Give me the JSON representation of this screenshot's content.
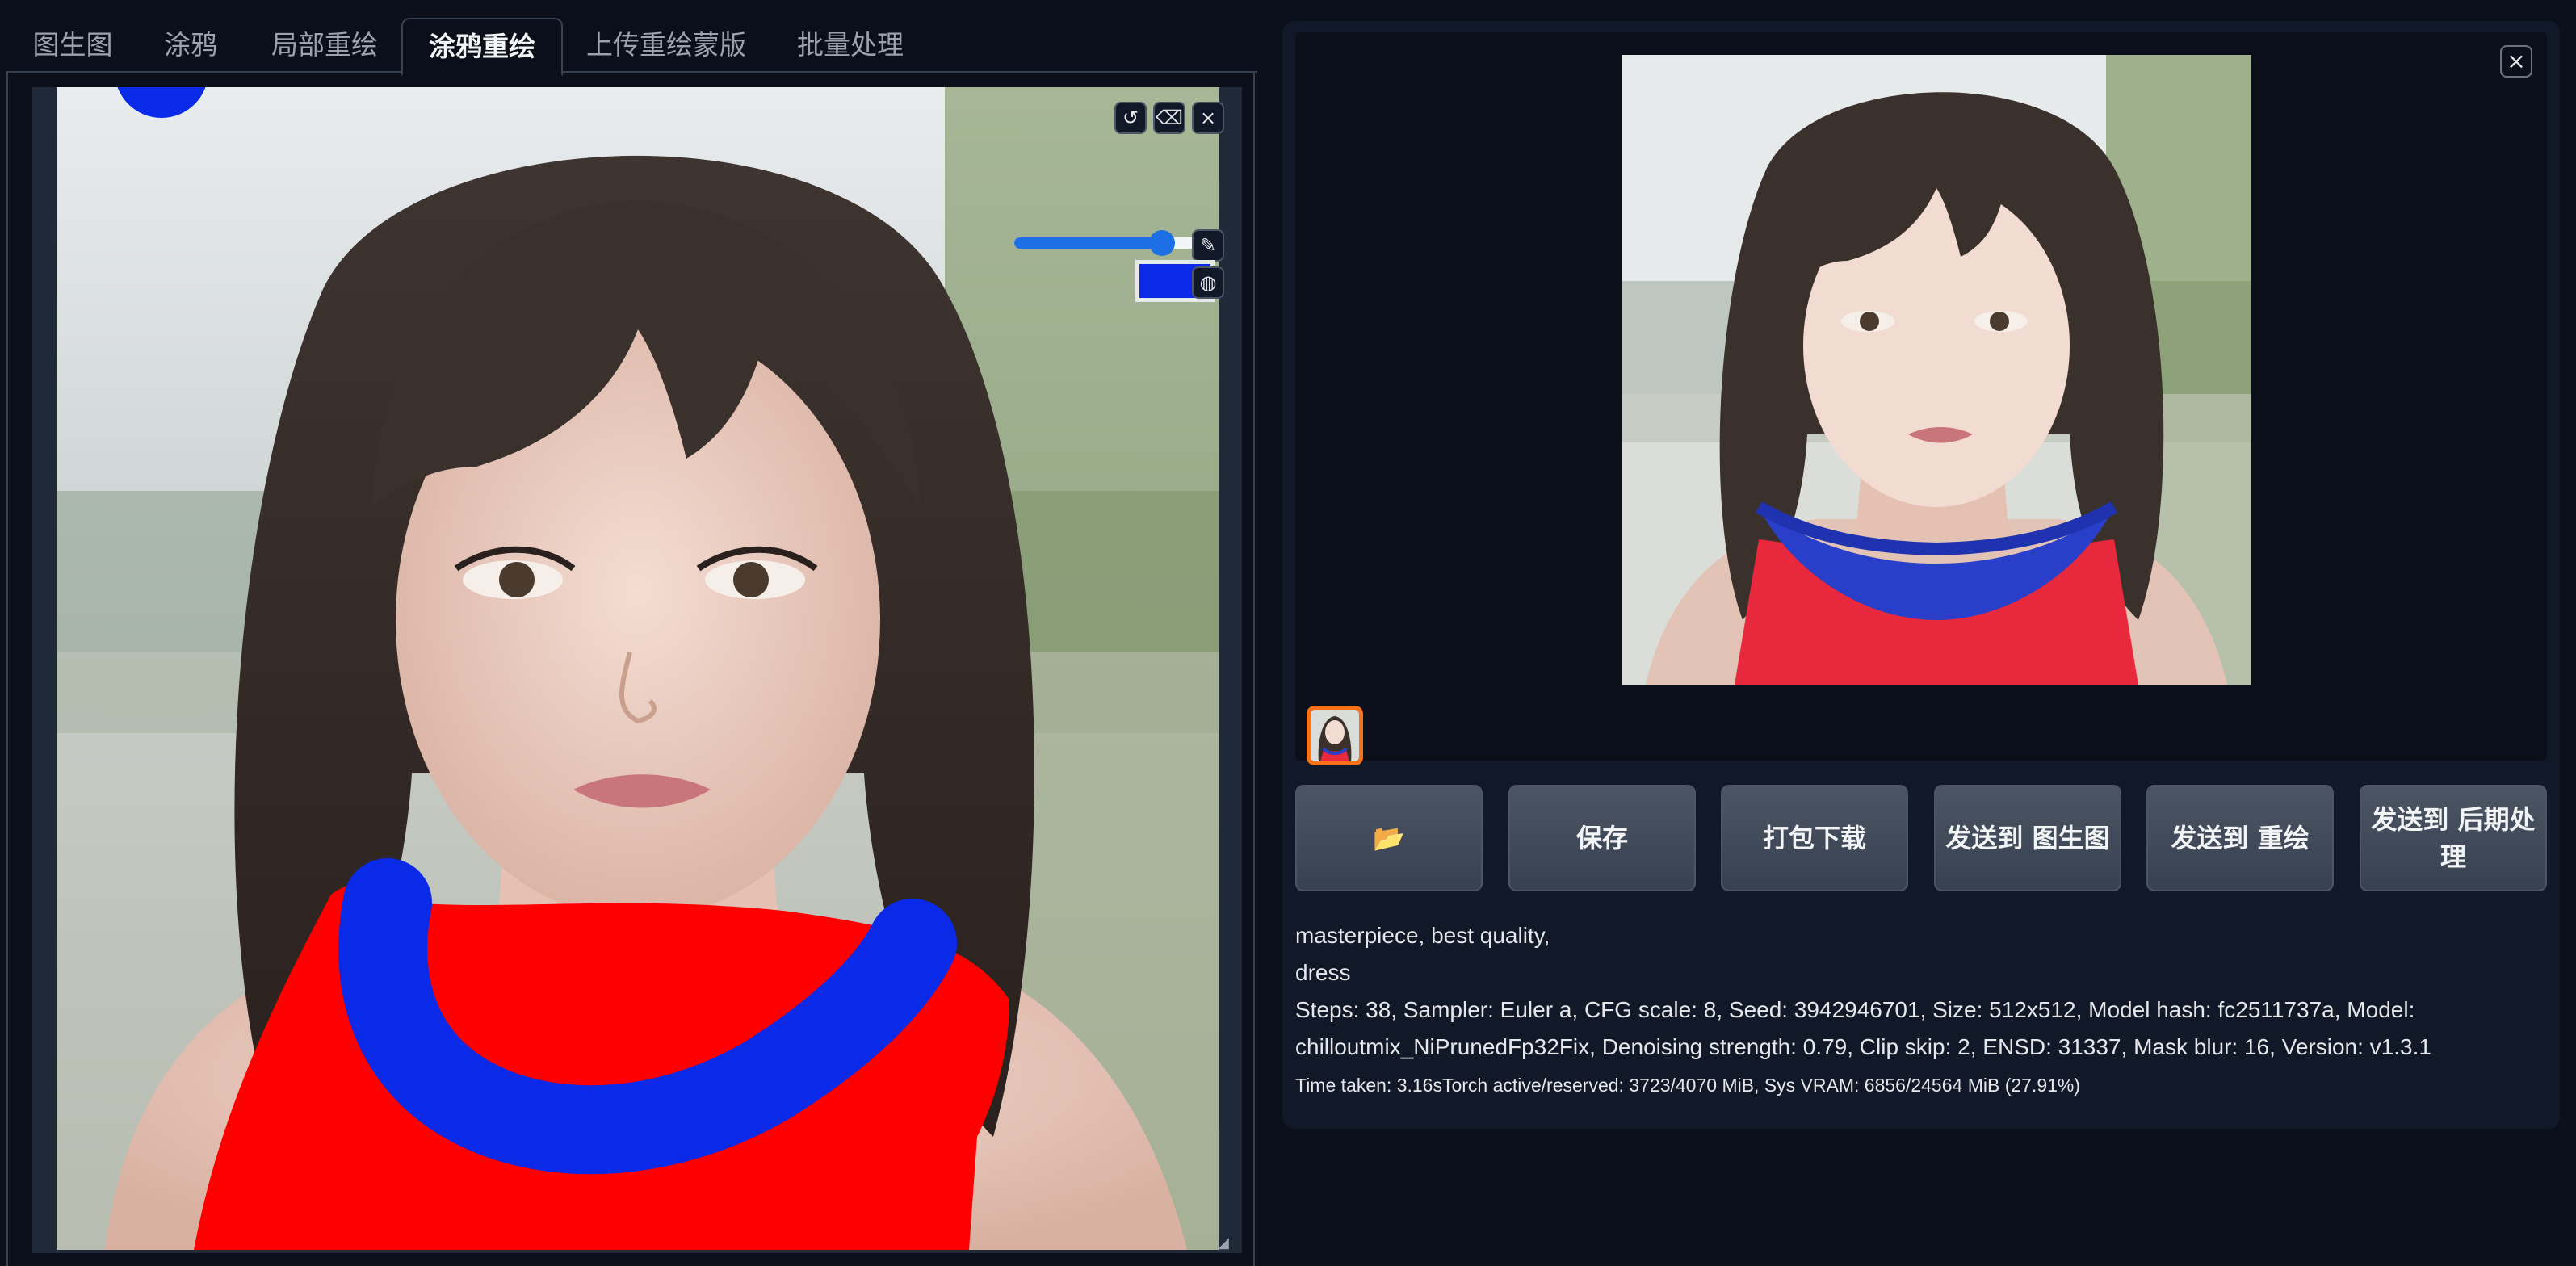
{
  "tabs": [
    {
      "label": "图生图",
      "active": false
    },
    {
      "label": "涂鸦",
      "active": false
    },
    {
      "label": "局部重绘",
      "active": false
    },
    {
      "label": "涂鸦重绘",
      "active": true
    },
    {
      "label": "上传重绘蒙版",
      "active": false
    },
    {
      "label": "批量处理",
      "active": false
    }
  ],
  "editor": {
    "brush_size_fraction": 0.73,
    "brush_color": "#0a2ae8",
    "icons": {
      "undo": "undo-icon",
      "eraser": "eraser-icon",
      "close": "close-icon",
      "brush": "brush-icon",
      "palette": "palette-icon"
    }
  },
  "output": {
    "close_icon": "×",
    "buttons": [
      {
        "label": "📂"
      },
      {
        "label": "保存"
      },
      {
        "label": "打包下载"
      },
      {
        "label": "发送到 图生图"
      },
      {
        "label": "发送到 重绘"
      },
      {
        "label": "发送到 后期处理"
      }
    ],
    "prompt_line1": "masterpiece, best quality,",
    "prompt_line2": "dress",
    "params_line1": "Steps: 38, Sampler: Euler a, CFG scale: 8, Seed: 3942946701, Size: 512x512, Model hash: fc2511737a, Model:",
    "params_line2": "chilloutmix_NiPrunedFp32Fix, Denoising strength: 0.79, Clip skip: 2, ENSD: 31337, Mask blur: 16, Version: v1.3.1",
    "time_taken": "Time taken: 3.16sTorch active/reserved: 3723/4070 MiB, Sys VRAM: 6856/24564 MiB (27.91%)"
  },
  "colors": {
    "background": "#0b0f19",
    "panel": "#111827",
    "accent": "#1d6fe6",
    "thumb_border": "#f97316",
    "dress_red": "#ff0000",
    "scribble_blue": "#0a2ae8"
  }
}
